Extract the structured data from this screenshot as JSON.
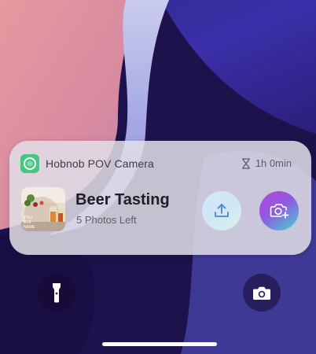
{
  "widget": {
    "app_name": "Hobnob POV Camera",
    "timer": "1h 0min",
    "event_title": "Beer Tasting",
    "photos_left": "5 Photos Left",
    "brand_color": "#42c97f",
    "thumbnail_text": [
      "YOU",
      "EVE",
      "NAME"
    ]
  },
  "icons": {
    "app": "hobnob-app-icon",
    "timer": "hourglass-icon",
    "upload": "upload-icon",
    "camera_add": "camera-plus-icon",
    "flashlight": "flashlight-icon",
    "lock_camera": "camera-icon"
  },
  "colors": {
    "upload_gradient": [
      "#d6ecf8",
      "#d9f3ea"
    ],
    "camera_gradient": [
      "#b24ad9",
      "#43d6cf"
    ]
  }
}
